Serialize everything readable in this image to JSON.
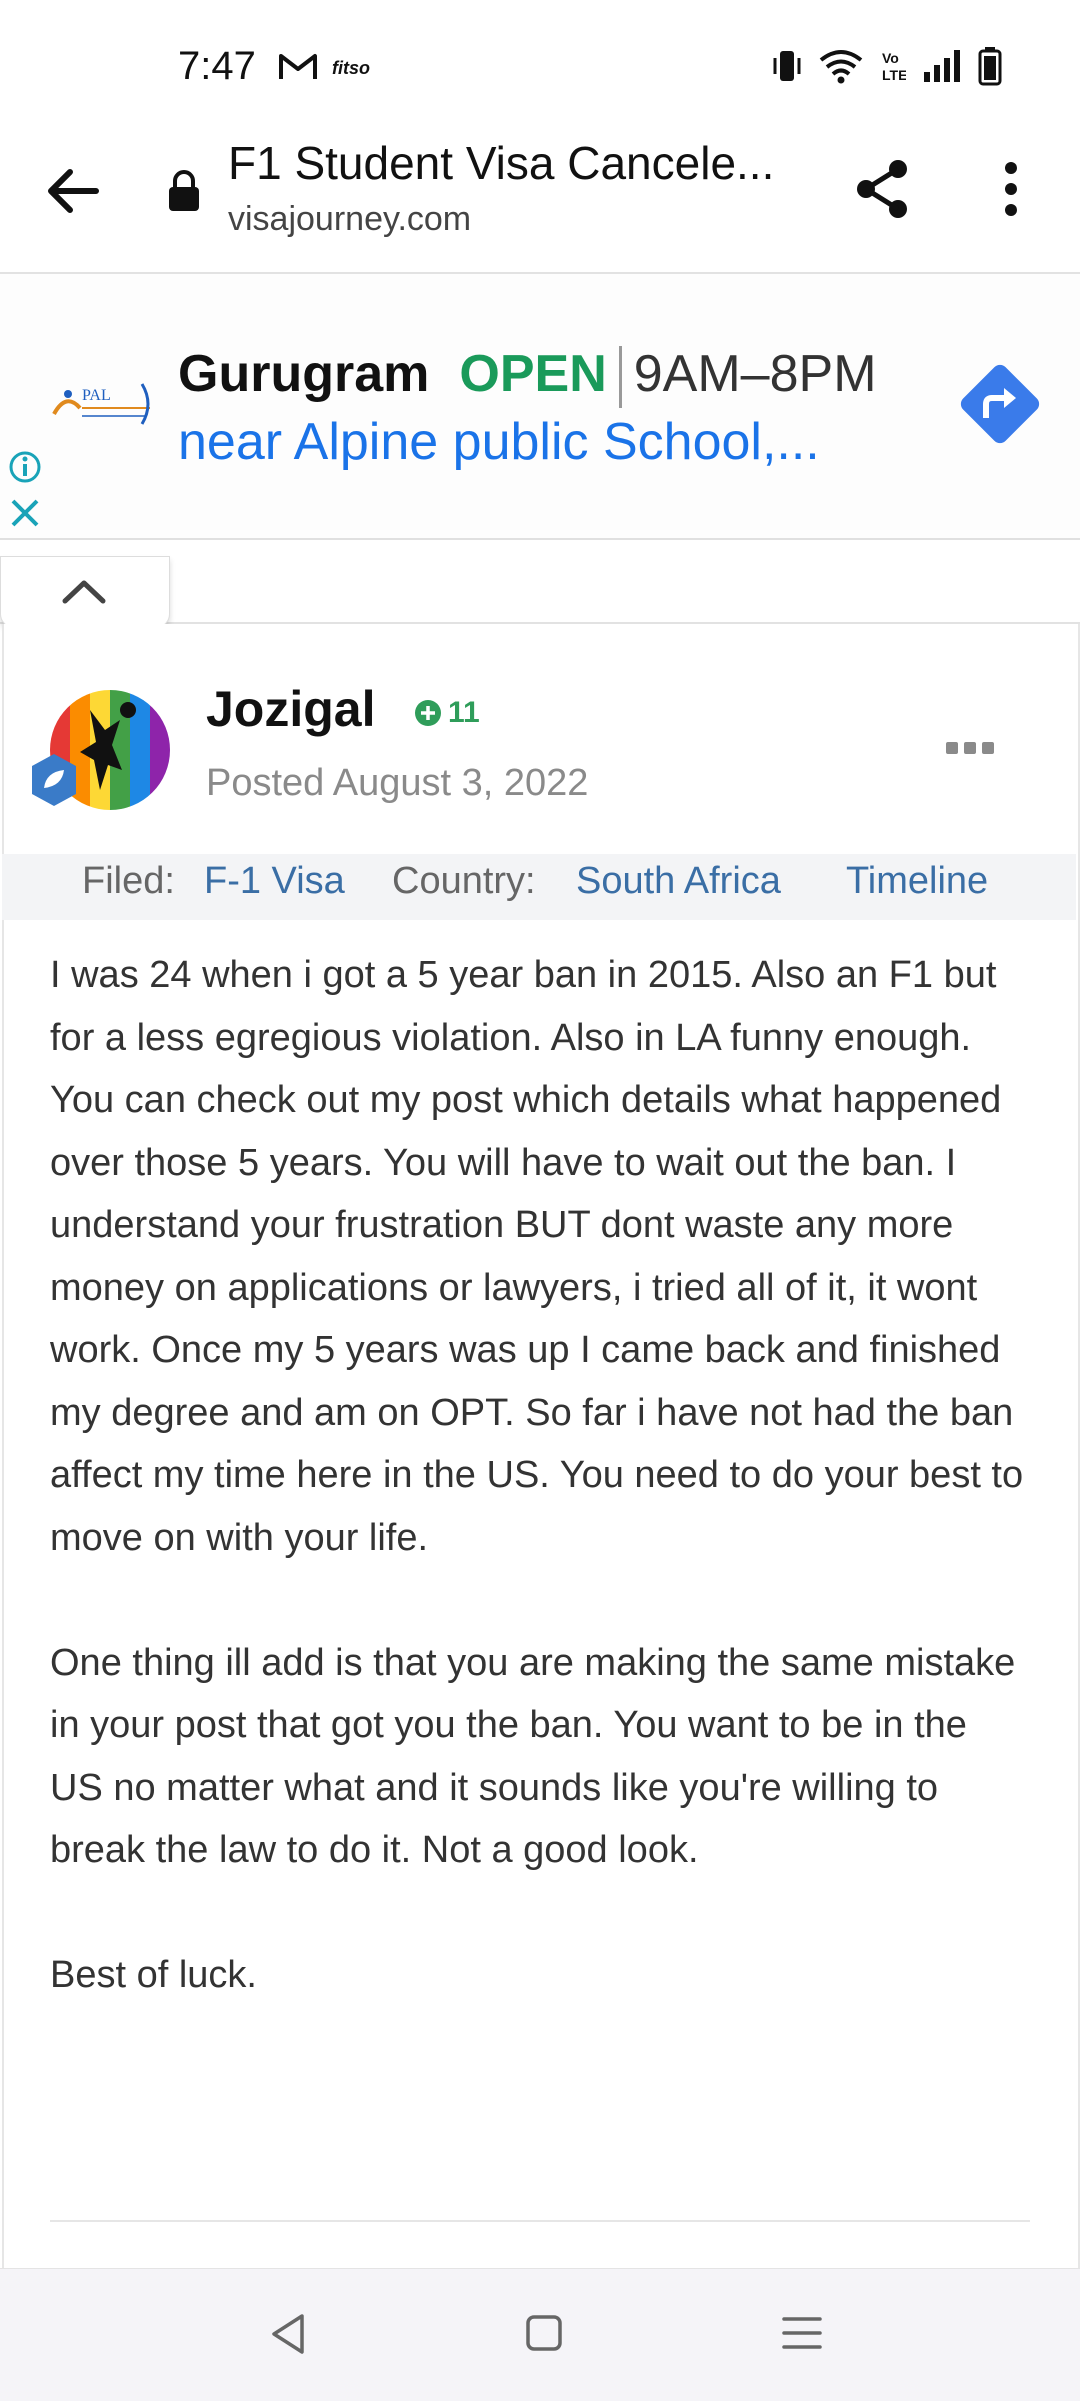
{
  "status_bar": {
    "time": "7:47",
    "app_label": "fitso"
  },
  "url_bar": {
    "title": "F1 Student Visa Cancele...",
    "domain": "visajourney.com"
  },
  "ad": {
    "logo_text": "PAL",
    "city": "Gurugram",
    "status": "OPEN",
    "hours": "9AM–8PM",
    "address": "near Alpine public School,..."
  },
  "post": {
    "author": "Jozigal",
    "reputation": "11",
    "posted": "Posted August 3, 2022",
    "filed_label": "Filed:",
    "filed_value": "F-1 Visa",
    "country_label": "Country:",
    "country_value": "South Africa",
    "timeline_label": "Timeline",
    "paragraphs": [
      "I was 24 when i got a 5 year ban in 2015. Also an F1 but for a less egregious violation. Also in LA funny enough. You can check out my post which details what happened over those 5 years. You will have to wait out the ban. I understand your frustration BUT dont waste any more money on applications or lawyers, i tried all of it, it wont work. Once my 5 years was up I came back and finished my degree and am on OPT. So far i have not had the ban affect my time here in the US. You need to do your best to move on with your life.",
      "One thing ill add is that you are making the same mistake in your post that got you the ban. You want to be in the US no matter what and it sounds like you're willing to break the law to do it. Not a good look.",
      "Best of luck."
    ]
  },
  "colors": {
    "open_green": "#1a9a5a",
    "link_blue": "#1a73e8",
    "meta_blue": "#3a6ea5",
    "rep_green": "#2f9d5a",
    "teal": "#19a3b8"
  }
}
